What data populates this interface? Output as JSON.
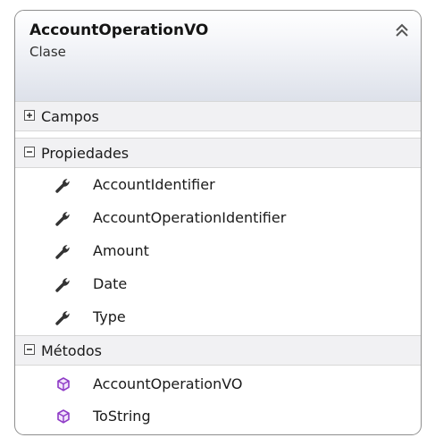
{
  "class_box": {
    "name": "AccountOperationVO",
    "kind": "Clase",
    "collapse_icon": "double-chevron-up-icon"
  },
  "sections": {
    "fields": {
      "label": "Campos",
      "state": "collapsed",
      "toggle_icon": "plus-box-icon"
    },
    "properties": {
      "label": "Propiedades",
      "state": "expanded",
      "toggle_icon": "minus-box-icon",
      "member_icon": "wrench-icon",
      "items": [
        "AccountIdentifier",
        "AccountOperationIdentifier",
        "Amount",
        "Date",
        "Type"
      ]
    },
    "methods": {
      "label": "Métodos",
      "state": "expanded",
      "toggle_icon": "minus-box-icon",
      "member_icon": "method-cube-icon",
      "items": [
        "AccountOperationVO",
        "ToString"
      ]
    }
  },
  "colors": {
    "border": "#8e8e8e",
    "header_gradient_end": "#dde1ea",
    "section_header": "#f1f1f3",
    "property_icon": "#333333",
    "method_icon": "#8e3ac6"
  }
}
